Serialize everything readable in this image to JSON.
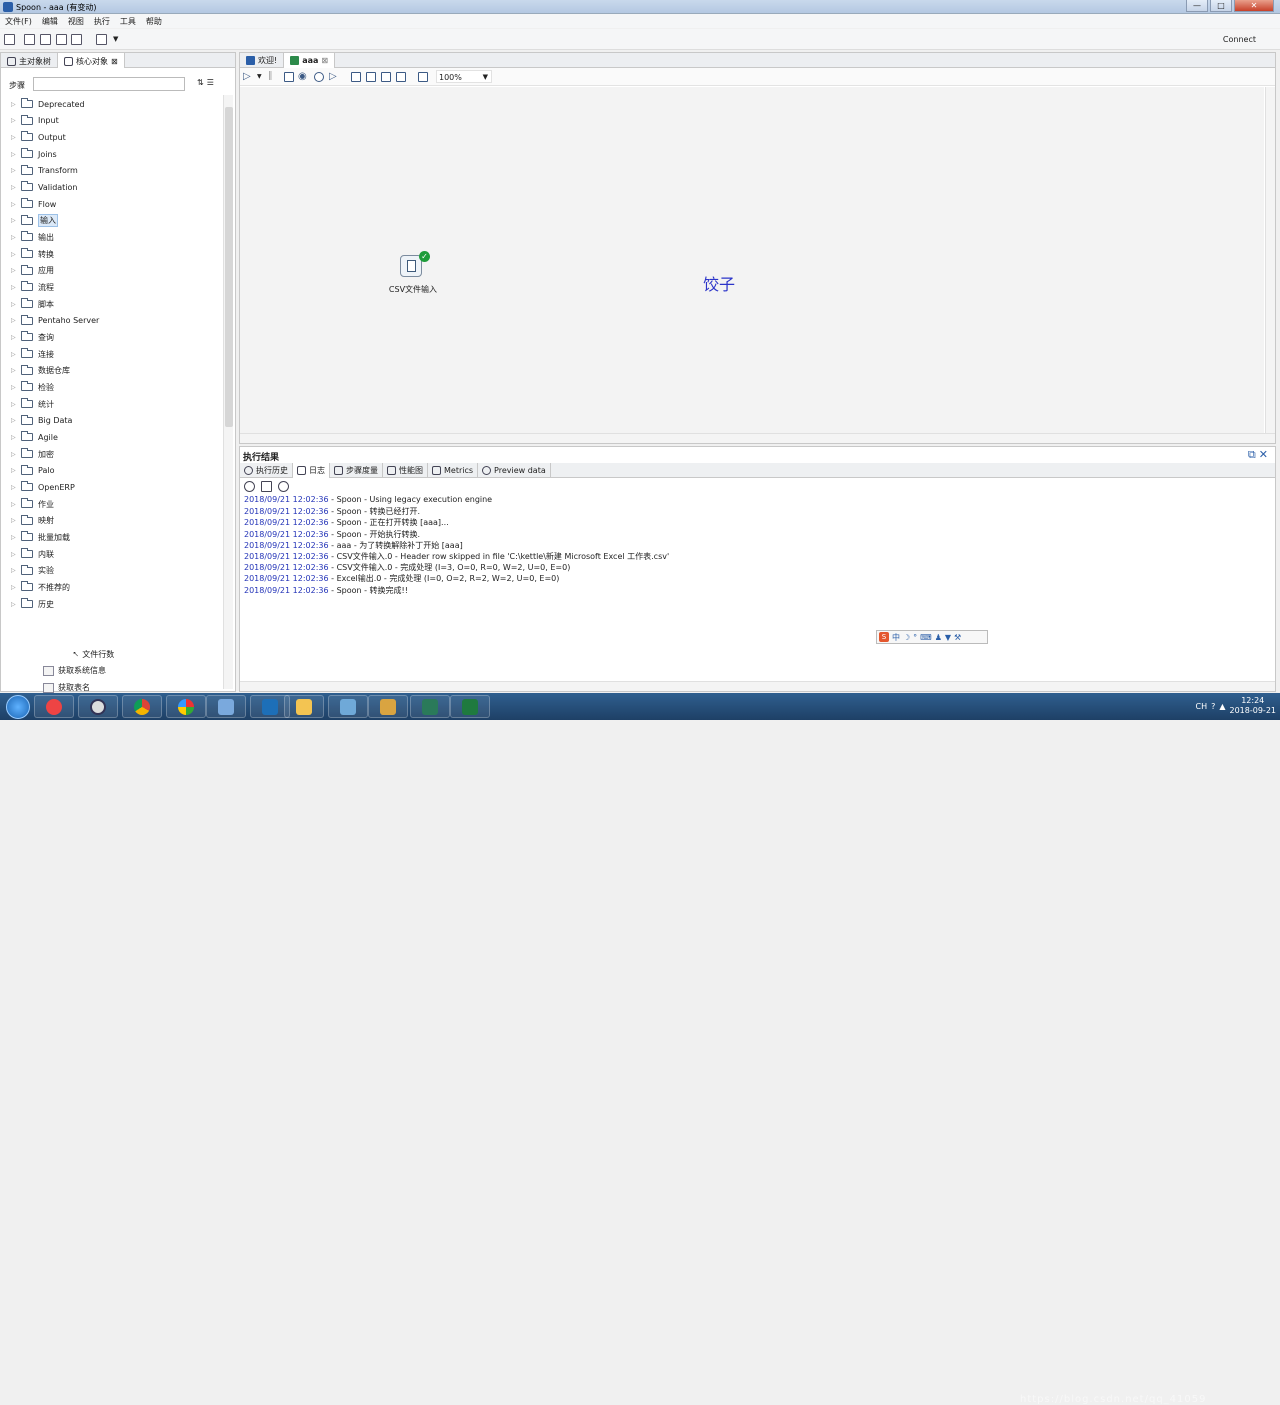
{
  "window": {
    "title": "Spoon - aaa (有变动)",
    "buttons": [
      "—",
      "□",
      "✕"
    ]
  },
  "menu": [
    "文件(F)",
    "编辑",
    "视图",
    "执行",
    "工具",
    "帮助"
  ],
  "toolbar": {
    "connect_label": "Connect"
  },
  "left_panel": {
    "tabs": [
      "主对象树",
      "核心对象"
    ],
    "steps_label": "步骤",
    "search_value": "",
    "tree": [
      "Deprecated",
      "Input",
      "Output",
      "Joins",
      "Transform",
      "Validation",
      "Flow",
      "输入",
      "输出",
      "转换",
      "应用",
      "流程",
      "脚本",
      "Pentaho Server",
      "查询",
      "连接",
      "数据仓库",
      "检验",
      "统计",
      "Big Data",
      "Agile",
      "加密",
      "Palo",
      "OpenERP",
      "作业",
      "映射",
      "批量加载",
      "内联",
      "实验",
      "不推荐的",
      "历史"
    ],
    "selected_index": 7,
    "bottom_items": [
      "文件行数",
      "获取系统信息",
      "获取表名"
    ]
  },
  "editor": {
    "tabs": [
      "欢迎!",
      "aaa"
    ],
    "zoom": "100%",
    "step_label": "CSV文件输入",
    "note": "饺子"
  },
  "results": {
    "title": "执行结果",
    "tabs": [
      "执行历史",
      "日志",
      "步骤度量",
      "性能图",
      "Metrics",
      "Preview data"
    ],
    "log": [
      {
        "ts": "2018/09/21 12:02:36",
        "msg": " - Spoon - Using legacy execution engine"
      },
      {
        "ts": "2018/09/21 12:02:36",
        "msg": " - Spoon - 转换已经打开."
      },
      {
        "ts": "2018/09/21 12:02:36",
        "msg": " - Spoon - 正在打开转换 [aaa]..."
      },
      {
        "ts": "2018/09/21 12:02:36",
        "msg": " - Spoon - 开始执行转换."
      },
      {
        "ts": "2018/09/21 12:02:36",
        "msg": " - aaa - 为了转换解除补丁开始  [aaa]"
      },
      {
        "ts": "2018/09/21 12:02:36",
        "msg": " - CSV文件输入.0 - Header row skipped in file 'C:\\kettle\\新建 Microsoft Excel 工作表.csv'"
      },
      {
        "ts": "2018/09/21 12:02:36",
        "msg": " - CSV文件输入.0 - 完成处理 (I=3, O=0, R=0, W=2, U=0, E=0)"
      },
      {
        "ts": "2018/09/21 12:02:36",
        "msg": " - Excel输出.0 - 完成处理 (I=0, O=2, R=2, W=2, U=0, E=0)"
      },
      {
        "ts": "2018/09/21 12:02:36",
        "msg": " - Spoon - 转换完成!!"
      }
    ],
    "ime_label": "中"
  },
  "taskbar": {
    "time": "12:24",
    "date": "2018-09-21",
    "tray_label": "CH",
    "watermark": "https://blog.csdn.net/qq_41059"
  }
}
